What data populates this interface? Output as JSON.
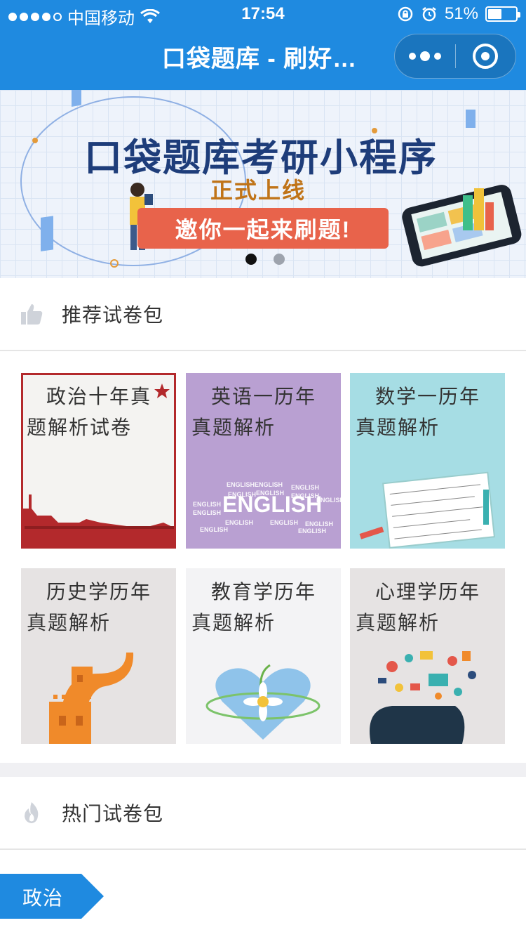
{
  "status_bar": {
    "carrier": "中国移动",
    "time": "17:54",
    "battery": "51%",
    "battery_level": 0.51,
    "signal_bars_filled": 4
  },
  "nav": {
    "title": "口袋题库 - 刷好…"
  },
  "banner": {
    "title": "口袋题库考研小程序",
    "subtitle": "正式上线",
    "button": "邀你一起来刷题!",
    "slides": 2,
    "active_slide": 1
  },
  "recommended": {
    "label": "推荐试卷包",
    "icon": "thumbs-up-icon",
    "items": [
      {
        "title": "政治十年真题解析试卷",
        "image": "political-frame"
      },
      {
        "title": "英语一历年真题解析",
        "image": "english-word-cloud",
        "art_text": "ENGLISH"
      },
      {
        "title": "数学一历年真题解析",
        "image": "math-notebook"
      },
      {
        "title": "历史学历年真题解析",
        "image": "great-wall"
      },
      {
        "title": "教育学历年真题解析",
        "image": "heart-flower"
      },
      {
        "title": "心理学历年真题解析",
        "image": "head-icons"
      }
    ]
  },
  "hot": {
    "label": "热门试卷包",
    "icon": "flame-icon"
  },
  "category_tag": {
    "label": "政治"
  },
  "colors": {
    "primary": "#1f8ae0",
    "english_bg": "#b9a0d2",
    "math_bg": "#a6dde4",
    "banner_btn": "#e8634b"
  }
}
